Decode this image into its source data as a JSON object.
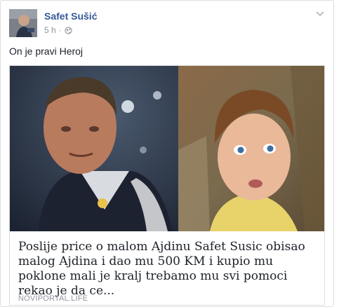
{
  "post": {
    "author": "Safet Sušić",
    "timestamp": "5 h",
    "separator": "·",
    "privacy_icon": "globe-icon",
    "options_icon": "chevron-down-icon",
    "text": "On je pravi Heroj"
  },
  "link": {
    "title": "Poslije price o malom Ajdinu Safet Susic obisao malog Ajdina i dao mu 500 KM i kupio mu poklone mali je kralj trebamo mu svi pomoci rekao je da ce...",
    "source": "NOVIPORTAL.LIFE"
  },
  "colors": {
    "author": "#365899",
    "text": "#1d2129",
    "meta": "#90949c",
    "border": "#dddfe2"
  }
}
